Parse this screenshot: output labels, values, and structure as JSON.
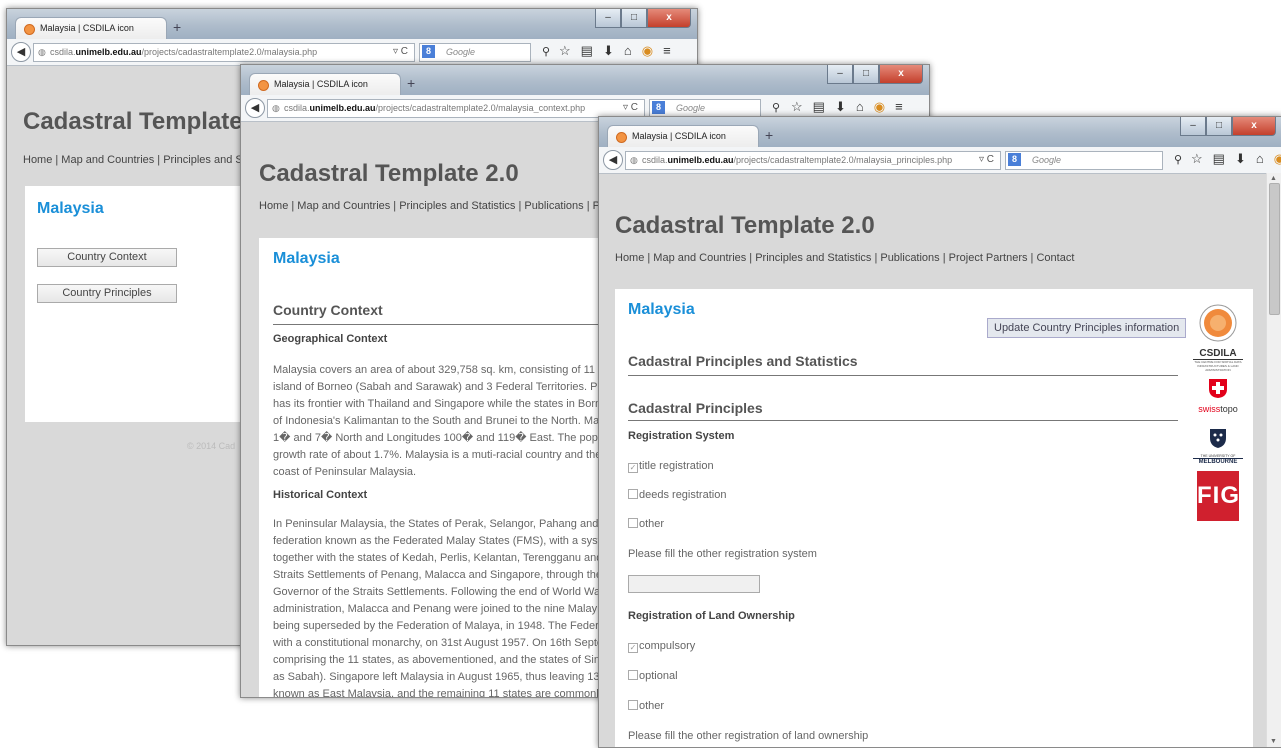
{
  "browser": {
    "tab_title": "Malaysia | CSDILA icon",
    "new_tab_symbol": "+",
    "search_engine": "Google",
    "search_badge": "8",
    "window_buttons": {
      "minimize": "–",
      "maximize": "□",
      "close": "x"
    },
    "icons": [
      "back-icon",
      "globe-icon",
      "reload-icon",
      "magnifier-icon",
      "star-icon",
      "bookmarks-icon",
      "download-icon",
      "home-icon",
      "extension-icon",
      "menu-icon"
    ]
  },
  "windows": [
    {
      "url_host": "csdila.",
      "url_domain": "unimelb.edu.au",
      "url_path": "/projects/cadastraltemplate2.0/malaysia.php",
      "site_title": "Cadastral Template",
      "nav": "Home | Map and Countries | Principles and St",
      "country": "Malaysia",
      "buttons": [
        "Country Context",
        "Country Principles"
      ],
      "footer": "© 2014 Cad"
    },
    {
      "url_host": "csdila.",
      "url_domain": "unimelb.edu.au",
      "url_path": "/projects/cadastraltemplate2.0/malaysia_context.php",
      "site_title": "Cadastral Template 2.0",
      "nav": "Home | Map and Countries | Principles and Statistics | Publications | Pr",
      "country": "Malaysia",
      "section": "Country Context",
      "geo_heading": "Geographical Context",
      "geo_text": "Malaysia covers an area of about 329,758 sq. km, consisting of 11 s\nisland of Borneo (Sabah and Sarawak) and 3 Federal Territories. Pe\nhas its frontier with Thailand and Singapore while the states in Borne\nof Indonesia's Kalimantan to the South and Brunei to the North. Malay\n1� and 7� North and Longitudes 100� and 119� East. The popul\ngrowth rate of about 1.7%. Malaysia is a muti-racial country and the m\ncoast of Peninsular Malaysia.",
      "hist_heading": "Historical Context",
      "hist_text": "In Peninsular Malaysia, the States of Perak, Selangor, Pahang and N\nfederation known as the Federated Malay States (FMS), with a syste\ntogether with the states of Kedah, Perlis, Kelantan, Terengganu and J\nStraits Settlements of Penang, Malacca and Singapore, through the \nGovernor of the Straits Settlements. Following the end of World War \nadministration, Malacca and Penang were joined to the nine Malay s\nbeing superseded by the Federation of Malaya, in 1948. The Federa\nwith a constitutional monarchy, on 31st August 1957. On 16th Septer\ncomprising the 11 states, as abovementioned, and the states of Sing\nas Sabah). Singapore left Malaysia in August 1965, thus leaving 13 s\nknown as East Malaysia, and the remaining 11 states are commonly"
    },
    {
      "url_host": "csdila.",
      "url_domain": "unimelb.edu.au",
      "url_path": "/projects/cadastraltemplate2.0/malaysia_principles.php",
      "site_title": "Cadastral Template 2.0",
      "nav": "Home | Map and Countries | Principles and Statistics | Publications | Project Partners | Contact",
      "country": "Malaysia",
      "update_button": "Update Country Principles information",
      "section1": "Cadastral Principles and Statistics",
      "section2": "Cadastral Principles",
      "reg_heading": "Registration System",
      "reg_options": [
        {
          "label": "title registration",
          "checked": true
        },
        {
          "label": "deeds registration",
          "checked": false
        },
        {
          "label": "other",
          "checked": false
        }
      ],
      "reg_other_label": "Please fill the other registration system",
      "own_heading": "Registration of Land Ownership",
      "own_options": [
        {
          "label": "compulsory",
          "checked": true
        },
        {
          "label": "optional",
          "checked": false
        },
        {
          "label": "other",
          "checked": false
        }
      ],
      "own_other_label": "Please fill the other registration of land ownership",
      "logos": {
        "csdila": "CSDILA",
        "csdila_sub": "THE CENTRE FOR SPATIAL DATA INFRASTRUCTURES & LAND ADMINISTRATION",
        "swiss_a": "swiss",
        "swiss_b": "topo",
        "melb_a": "THE UNIVERSITY OF",
        "melb_b": "MELBOURNE",
        "fig": "FIG"
      }
    }
  ]
}
